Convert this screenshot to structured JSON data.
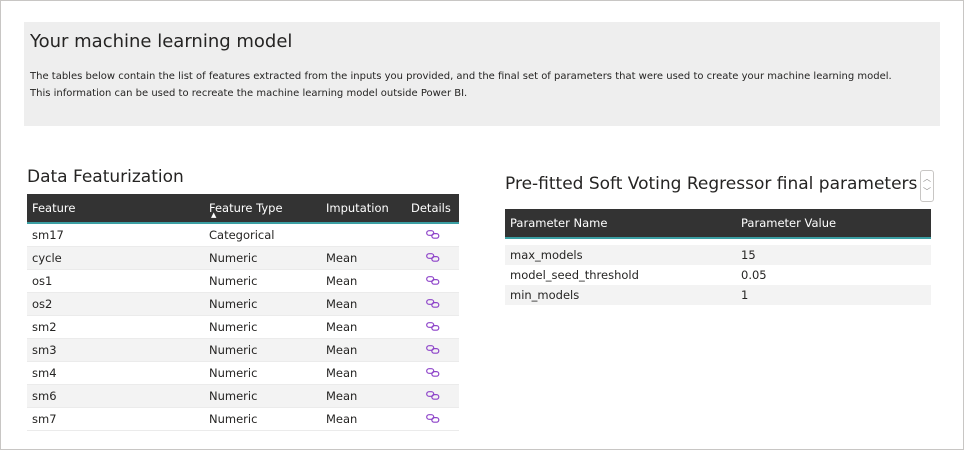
{
  "banner": {
    "title": "Your machine learning model",
    "description": "The tables below contain the list of features extracted from the inputs you provided, and the final set of parameters that were used to create your machine learning model.  This information can be used to recreate the machine learning model outside Power BI."
  },
  "featurization": {
    "title": "Data Featurization",
    "columns": [
      "Feature",
      "Feature Type",
      "Imputation",
      "Details"
    ],
    "sorted_column": "Feature Type",
    "rows": [
      {
        "feature": "sm17",
        "type": "Categorical",
        "imputation": ""
      },
      {
        "feature": "cycle",
        "type": "Numeric",
        "imputation": "Mean"
      },
      {
        "feature": "os1",
        "type": "Numeric",
        "imputation": "Mean"
      },
      {
        "feature": "os2",
        "type": "Numeric",
        "imputation": "Mean"
      },
      {
        "feature": "sm2",
        "type": "Numeric",
        "imputation": "Mean"
      },
      {
        "feature": "sm3",
        "type": "Numeric",
        "imputation": "Mean"
      },
      {
        "feature": "sm4",
        "type": "Numeric",
        "imputation": "Mean"
      },
      {
        "feature": "sm6",
        "type": "Numeric",
        "imputation": "Mean"
      },
      {
        "feature": "sm7",
        "type": "Numeric",
        "imputation": "Mean"
      }
    ],
    "details_icon": "link-icon"
  },
  "parameters": {
    "title": "Pre-fitted Soft Voting Regressor final parameters",
    "columns": [
      "Parameter Name",
      "Parameter Value"
    ],
    "rows": [
      {
        "name": "max_models",
        "value": "15"
      },
      {
        "name": "model_seed_threshold",
        "value": "0.05"
      },
      {
        "name": "min_models",
        "value": "1"
      }
    ]
  },
  "colors": {
    "banner_bg": "#eeeeee",
    "header_bg": "#333333",
    "header_accent": "#3b9fa3",
    "link_icon": "#8e44c9"
  }
}
